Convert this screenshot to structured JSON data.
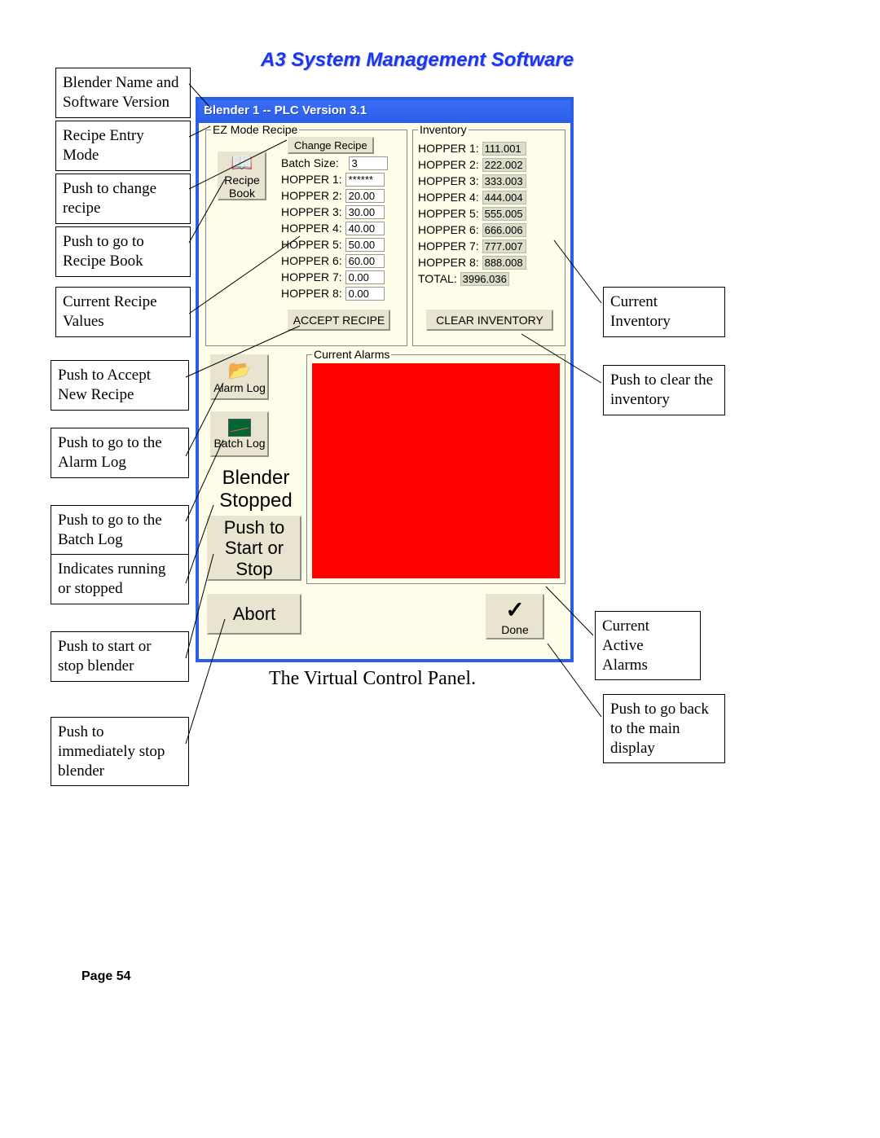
{
  "doc": {
    "header": "A3 System Management Software",
    "caption": "The Virtual Control Panel.",
    "page": "Page 54"
  },
  "callouts": {
    "blender_name": "Blender Name and Software Version",
    "recipe_entry": "Recipe Entry Mode",
    "push_change": "Push to change recipe",
    "push_recipe_book": "Push to go to Recipe Book",
    "current_recipe": "Current Recipe Values",
    "push_accept": "Push to Accept New Recipe",
    "push_alarm": "Push to go to the Alarm Log",
    "push_batch": "Push to go to the Batch Log",
    "indicates": "Indicates running or stopped",
    "push_start": "Push to start or  stop blender",
    "push_abort": "Push to immediately stop blender",
    "current_inventory": "Current Inventory",
    "push_clear": "Push to clear the inventory",
    "active_alarms": "Current Active Alarms",
    "push_done": "Push to go back to the main display"
  },
  "window": {
    "title": "Blender 1  --  PLC Version 3.1",
    "ez_legend": "EZ Mode Recipe",
    "inv_legend": "Inventory",
    "alarms_legend": "Current Alarms",
    "change_recipe_btn": "Change Recipe",
    "recipe_book_btn": "Recipe\nBook",
    "alarm_log_btn": "Alarm Log",
    "batch_log_btn": "Batch Log",
    "accept_btn": "ACCEPT RECIPE",
    "clear_btn": "CLEAR INVENTORY",
    "abort_btn": "Abort",
    "done_btn": "Done",
    "status_text": "Blender Stopped",
    "start_stop_btn": "Push to Start or Stop",
    "batch_size_label": "Batch Size:",
    "batch_size_value": "3",
    "recipe": [
      {
        "label": "HOPPER 1:",
        "value": "******"
      },
      {
        "label": "HOPPER 2:",
        "value": "20.00"
      },
      {
        "label": "HOPPER 3:",
        "value": "30.00"
      },
      {
        "label": "HOPPER 4:",
        "value": "40.00"
      },
      {
        "label": "HOPPER 5:",
        "value": "50.00"
      },
      {
        "label": "HOPPER 6:",
        "value": "60.00"
      },
      {
        "label": "HOPPER 7:",
        "value": "0.00"
      },
      {
        "label": "HOPPER 8:",
        "value": "0.00"
      }
    ],
    "inventory": [
      {
        "label": "HOPPER 1:",
        "value": "111.001"
      },
      {
        "label": "HOPPER 2:",
        "value": "222.002"
      },
      {
        "label": "HOPPER 3:",
        "value": "333.003"
      },
      {
        "label": "HOPPER 4:",
        "value": "444.004"
      },
      {
        "label": "HOPPER 5:",
        "value": "555.005"
      },
      {
        "label": "HOPPER 6:",
        "value": "666.006"
      },
      {
        "label": "HOPPER 7:",
        "value": "777.007"
      },
      {
        "label": "HOPPER 8:",
        "value": "888.008"
      },
      {
        "label": "TOTAL:",
        "value": "3996.036"
      }
    ]
  }
}
